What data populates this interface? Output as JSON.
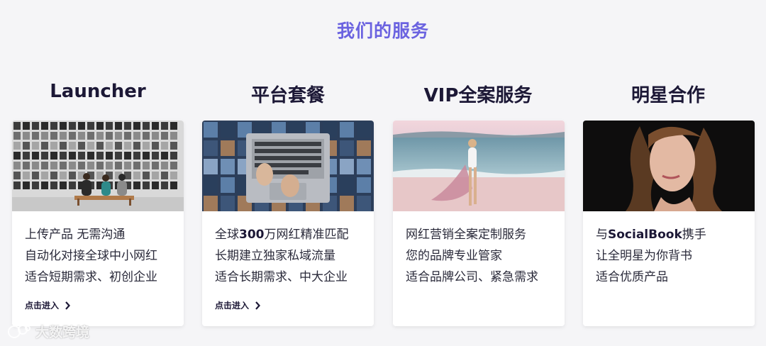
{
  "section": {
    "title": "我们的服务"
  },
  "cards": [
    {
      "title": "Launcher",
      "lines": [
        "上传产品 无需沟通",
        "自动化对接全球中小网红",
        "适合短期需求、初创企业"
      ],
      "link": "点击进入"
    },
    {
      "title": "平台套餐",
      "lines": [
        {
          "pre": "全球",
          "bold": "300",
          "post": "万网红精准匹配"
        },
        "长期建立独家私域流量",
        "适合长期需求、中大企业"
      ],
      "link": "点击进入"
    },
    {
      "title": "VIP全案服务",
      "lines": [
        "网红营销全案定制服务",
        "您的品牌专业管家",
        "适合品牌公司、紧急需求"
      ]
    },
    {
      "title": "明星合作",
      "lines": [
        {
          "pre": "与",
          "bold": "SocialBook",
          "post": "携手"
        },
        "让全明星为你背书",
        "适合优质产品"
      ]
    }
  ],
  "watermark": {
    "text": "大数跨境"
  },
  "colors": {
    "accent": "#6b63e0",
    "heading": "#1c1836",
    "background": "#f5f5f7"
  },
  "icons": {
    "link_arrow": "chevron-right-icon",
    "watermark_logo": "logo-icon"
  }
}
